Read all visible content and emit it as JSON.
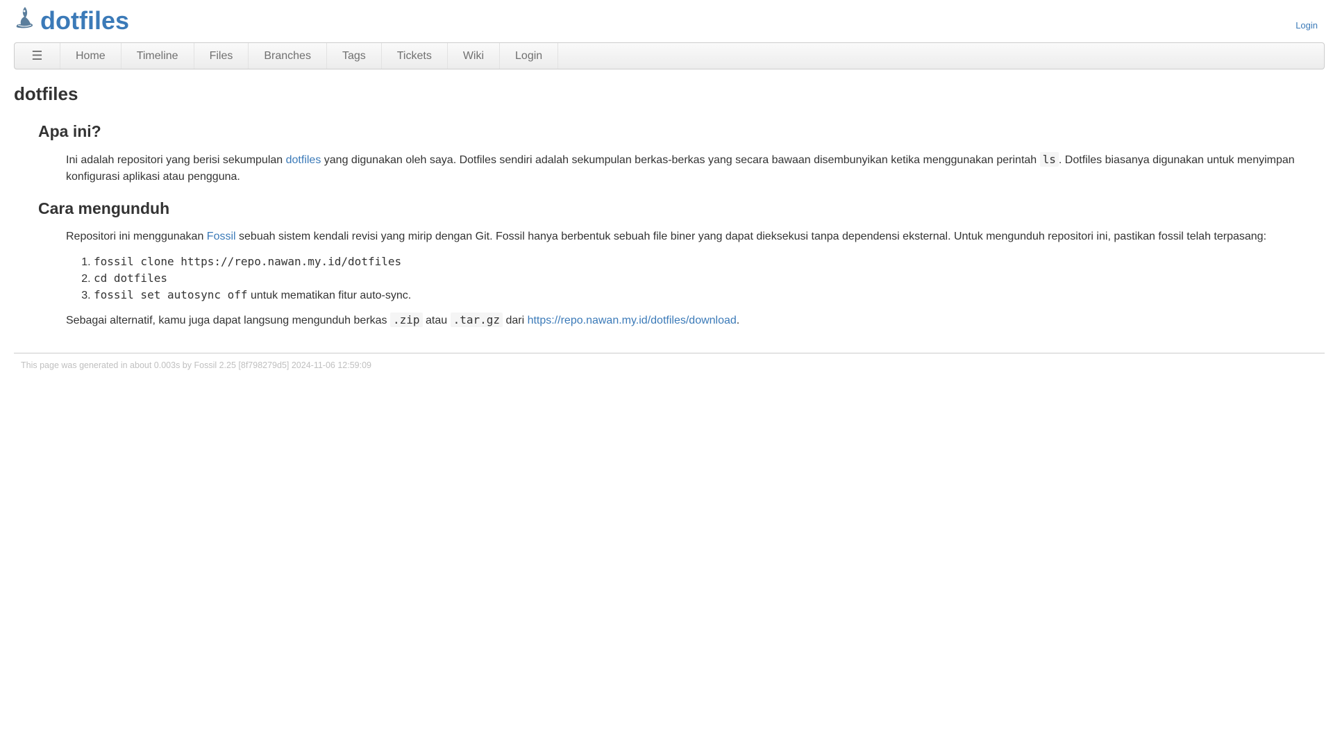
{
  "header": {
    "title": "dotfiles",
    "login_label": "Login"
  },
  "mainmenu": {
    "hamburger": "☰",
    "items": [
      {
        "label": "Home"
      },
      {
        "label": "Timeline"
      },
      {
        "label": "Files"
      },
      {
        "label": "Branches"
      },
      {
        "label": "Tags"
      },
      {
        "label": "Tickets"
      },
      {
        "label": "Wiki"
      },
      {
        "label": "Login"
      }
    ]
  },
  "content": {
    "page_title": "dotfiles",
    "section1": {
      "heading": "Apa ini?",
      "p_start": "Ini adalah repositori yang berisi sekumpulan ",
      "link_dotfiles": "dotfiles",
      "p_mid": " yang digunakan oleh saya. Dotfiles sendiri adalah sekumpulan berkas-berkas yang secara bawaan disembunyikan ketika menggunakan perintah ",
      "code_ls": "ls",
      "p_end": ". Dotfiles biasanya digunakan untuk menyimpan konfigurasi aplikasi atau pengguna."
    },
    "section2": {
      "heading": "Cara mengunduh",
      "p_start": "Repositori ini menggunakan ",
      "link_fossil": "Fossil",
      "p_end": " sebuah sistem kendali revisi yang mirip dengan Git. Fossil hanya berbentuk sebuah file biner yang dapat dieksekusi tanpa dependensi eksternal. Untuk mengunduh repositori ini, pastikan fossil telah terpasang:",
      "steps": [
        {
          "code": "fossil clone https://repo.nawan.my.id/dotfiles",
          "suffix": ""
        },
        {
          "code": "cd dotfiles",
          "suffix": ""
        },
        {
          "code": "fossil set autosync off",
          "suffix": " untuk mematikan fitur auto-sync."
        }
      ],
      "alt_start": "Sebagai alternatif, kamu juga dapat langsung mengunduh berkas ",
      "code_zip": ".zip",
      "alt_atau": " atau ",
      "code_targz": ".tar.gz",
      "alt_dari": " dari ",
      "download_link": "https://repo.nawan.my.id/dotfiles/download",
      "alt_end": "."
    }
  },
  "footer": {
    "text": "This page was generated in about 0.003s by Fossil 2.25 [8f798279d5] 2024-11-06 12:59:09"
  }
}
